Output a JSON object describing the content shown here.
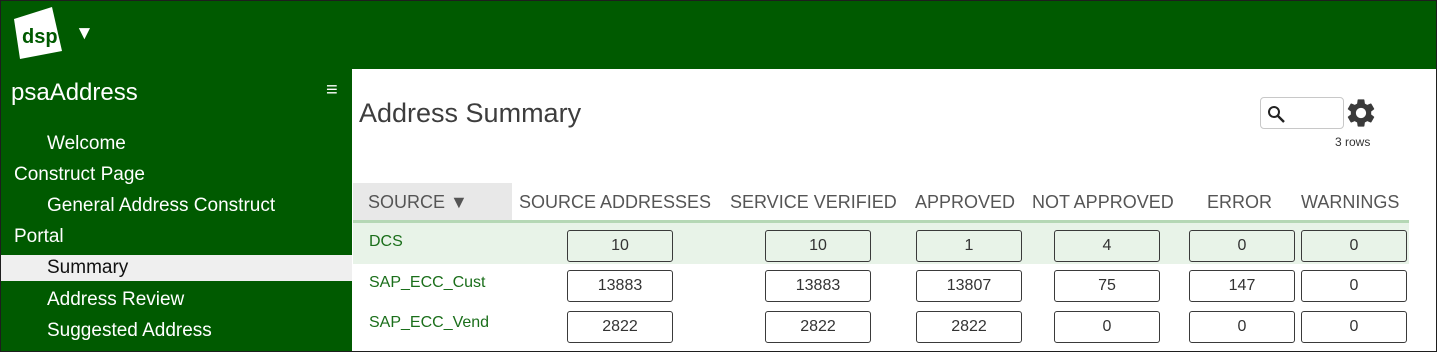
{
  "header": {
    "logo_text": "dsp",
    "menu_arrow": "▼"
  },
  "sidebar": {
    "title": "psaAddress",
    "menu_icon": "≡",
    "items": [
      {
        "label": "Welcome",
        "level": 2,
        "active": false
      },
      {
        "label": "Construct Page",
        "level": 1,
        "active": false
      },
      {
        "label": "General Address Construct",
        "level": 2,
        "active": false
      },
      {
        "label": "Portal",
        "level": 1,
        "active": false
      },
      {
        "label": "Summary",
        "level": 2,
        "active": true
      },
      {
        "label": "Address Review",
        "level": 2,
        "active": false
      },
      {
        "label": "Suggested Address",
        "level": 2,
        "active": false
      }
    ]
  },
  "main": {
    "title": "Address Summary",
    "rows_count": "3 rows",
    "columns": [
      "SOURCE ▼",
      "SOURCE ADDRESSES",
      "SERVICE VERIFIED",
      "APPROVED",
      "NOT APPROVED",
      "ERROR",
      "WARNINGS"
    ],
    "rows": [
      {
        "source": "DCS",
        "values": [
          "10",
          "10",
          "1",
          "4",
          "0",
          "0"
        ],
        "highlighted": true
      },
      {
        "source": "SAP_ECC_Cust",
        "values": [
          "13883",
          "13883",
          "13807",
          "75",
          "147",
          "0"
        ],
        "highlighted": false
      },
      {
        "source": "SAP_ECC_Vend",
        "values": [
          "2822",
          "2822",
          "2822",
          "0",
          "0",
          "0"
        ],
        "highlighted": false
      }
    ]
  },
  "colors": {
    "brand_green": "#005a00",
    "row_highlight": "#e8f3e8",
    "source_link": "#1a6e1a"
  },
  "icons": [
    "logo-icon",
    "dropdown-arrow-icon",
    "hamburger-icon",
    "search-icon",
    "gear-icon",
    "sort-desc-icon"
  ]
}
